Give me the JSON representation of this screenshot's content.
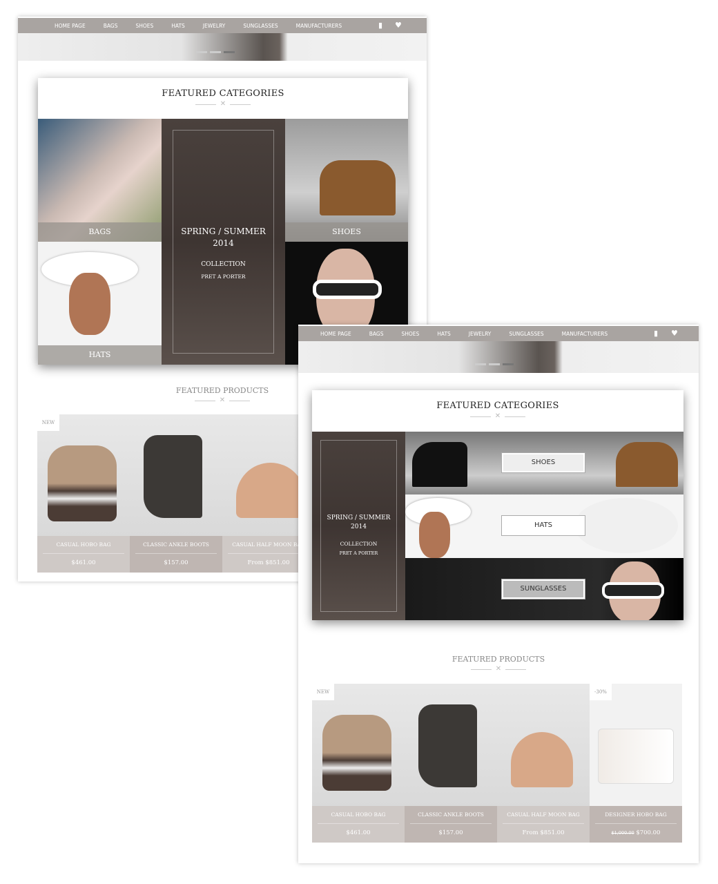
{
  "nav": {
    "items": [
      "HOME PAGE",
      "BAGS",
      "SHOES",
      "HATS",
      "JEWELRY",
      "SUNGLASSES",
      "MANUFACTURERS"
    ],
    "icons": [
      "shopping-bag-icon",
      "heart-icon"
    ]
  },
  "featured_categories": {
    "title": "FEATURED CATEGORIES",
    "tiles": [
      "BAGS",
      "SHOES",
      "HATS"
    ],
    "promo": {
      "title": "SPRING / SUMMER",
      "year": "2014",
      "collection": "COLLECTION",
      "sub": "PRET A PORTER"
    },
    "buttons": [
      "SHOES",
      "HATS",
      "SUNGLASSES"
    ]
  },
  "featured_products": {
    "title": "FEATURED PRODUCTS",
    "items": [
      {
        "name": "CASUAL HOBO BAG",
        "price": "$461.00",
        "badge": "NEW"
      },
      {
        "name": "CLASSIC ANKLE BOOTS",
        "price": "$157.00"
      },
      {
        "name": "CASUAL HALF MOON BAG",
        "price": "From $851.00"
      },
      {
        "name": "DESIGNER HOBO BAG",
        "old_price": "$1,000.00",
        "price": "$700.00",
        "badge": "-30%"
      }
    ]
  },
  "colors": {
    "nav": "#a9a4a1",
    "promo": "#443b37",
    "caption_light": "#cfc9c6",
    "caption_dark": "#bfb6b2"
  }
}
